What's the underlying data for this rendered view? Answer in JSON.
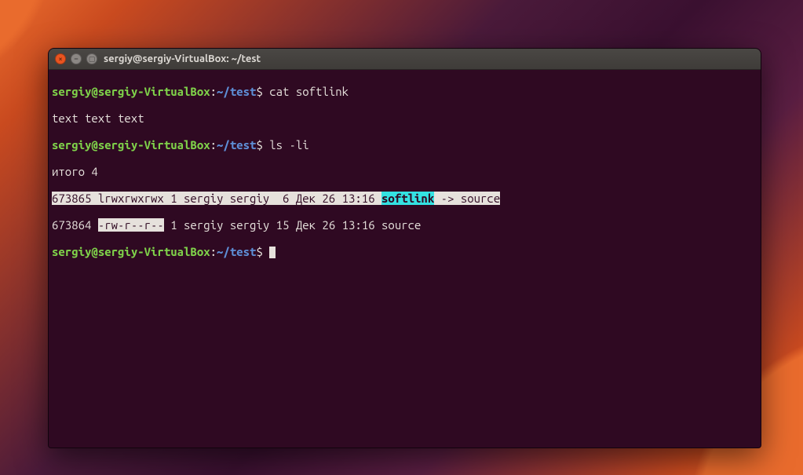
{
  "window": {
    "title": "sergiy@sergiy-VirtualBox: ~/test"
  },
  "prompt": {
    "user": "sergiy",
    "at": "@",
    "host": "sergiy-VirtualBox",
    "colon": ":",
    "path": "~/test",
    "dollar": "$"
  },
  "lines": {
    "cmd1": " cat softlink",
    "out1": "text text text",
    "cmd2": " ls -li",
    "out2": "итого 4",
    "ls1": {
      "a": "673865 lrwxrwxrwx 1 sergiy sergiy  6 Дек 26 13:16 ",
      "link": "softlink",
      "b": " -> source"
    },
    "ls2": {
      "a": "673864 ",
      "perm_sel": "-rw-r--r--",
      "b": " 1 sergiy sergiy 15 Дек 26 13:16 source"
    }
  }
}
